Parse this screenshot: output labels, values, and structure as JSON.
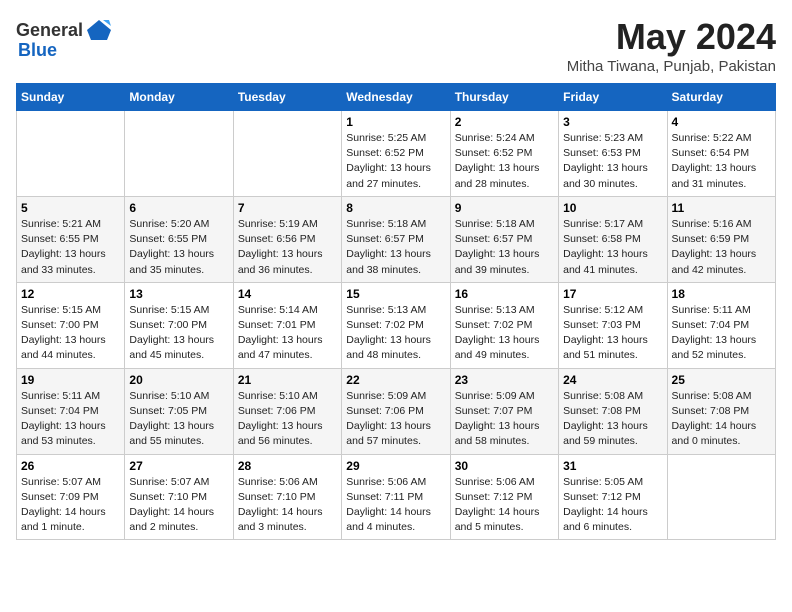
{
  "header": {
    "logo_general": "General",
    "logo_blue": "Blue",
    "month_title": "May 2024",
    "location": "Mitha Tiwana, Punjab, Pakistan"
  },
  "weekdays": [
    "Sunday",
    "Monday",
    "Tuesday",
    "Wednesday",
    "Thursday",
    "Friday",
    "Saturday"
  ],
  "weeks": [
    [
      {
        "day": "",
        "info": ""
      },
      {
        "day": "",
        "info": ""
      },
      {
        "day": "",
        "info": ""
      },
      {
        "day": "1",
        "info": "Sunrise: 5:25 AM\nSunset: 6:52 PM\nDaylight: 13 hours\nand 27 minutes."
      },
      {
        "day": "2",
        "info": "Sunrise: 5:24 AM\nSunset: 6:52 PM\nDaylight: 13 hours\nand 28 minutes."
      },
      {
        "day": "3",
        "info": "Sunrise: 5:23 AM\nSunset: 6:53 PM\nDaylight: 13 hours\nand 30 minutes."
      },
      {
        "day": "4",
        "info": "Sunrise: 5:22 AM\nSunset: 6:54 PM\nDaylight: 13 hours\nand 31 minutes."
      }
    ],
    [
      {
        "day": "5",
        "info": "Sunrise: 5:21 AM\nSunset: 6:55 PM\nDaylight: 13 hours\nand 33 minutes."
      },
      {
        "day": "6",
        "info": "Sunrise: 5:20 AM\nSunset: 6:55 PM\nDaylight: 13 hours\nand 35 minutes."
      },
      {
        "day": "7",
        "info": "Sunrise: 5:19 AM\nSunset: 6:56 PM\nDaylight: 13 hours\nand 36 minutes."
      },
      {
        "day": "8",
        "info": "Sunrise: 5:18 AM\nSunset: 6:57 PM\nDaylight: 13 hours\nand 38 minutes."
      },
      {
        "day": "9",
        "info": "Sunrise: 5:18 AM\nSunset: 6:57 PM\nDaylight: 13 hours\nand 39 minutes."
      },
      {
        "day": "10",
        "info": "Sunrise: 5:17 AM\nSunset: 6:58 PM\nDaylight: 13 hours\nand 41 minutes."
      },
      {
        "day": "11",
        "info": "Sunrise: 5:16 AM\nSunset: 6:59 PM\nDaylight: 13 hours\nand 42 minutes."
      }
    ],
    [
      {
        "day": "12",
        "info": "Sunrise: 5:15 AM\nSunset: 7:00 PM\nDaylight: 13 hours\nand 44 minutes."
      },
      {
        "day": "13",
        "info": "Sunrise: 5:15 AM\nSunset: 7:00 PM\nDaylight: 13 hours\nand 45 minutes."
      },
      {
        "day": "14",
        "info": "Sunrise: 5:14 AM\nSunset: 7:01 PM\nDaylight: 13 hours\nand 47 minutes."
      },
      {
        "day": "15",
        "info": "Sunrise: 5:13 AM\nSunset: 7:02 PM\nDaylight: 13 hours\nand 48 minutes."
      },
      {
        "day": "16",
        "info": "Sunrise: 5:13 AM\nSunset: 7:02 PM\nDaylight: 13 hours\nand 49 minutes."
      },
      {
        "day": "17",
        "info": "Sunrise: 5:12 AM\nSunset: 7:03 PM\nDaylight: 13 hours\nand 51 minutes."
      },
      {
        "day": "18",
        "info": "Sunrise: 5:11 AM\nSunset: 7:04 PM\nDaylight: 13 hours\nand 52 minutes."
      }
    ],
    [
      {
        "day": "19",
        "info": "Sunrise: 5:11 AM\nSunset: 7:04 PM\nDaylight: 13 hours\nand 53 minutes."
      },
      {
        "day": "20",
        "info": "Sunrise: 5:10 AM\nSunset: 7:05 PM\nDaylight: 13 hours\nand 55 minutes."
      },
      {
        "day": "21",
        "info": "Sunrise: 5:10 AM\nSunset: 7:06 PM\nDaylight: 13 hours\nand 56 minutes."
      },
      {
        "day": "22",
        "info": "Sunrise: 5:09 AM\nSunset: 7:06 PM\nDaylight: 13 hours\nand 57 minutes."
      },
      {
        "day": "23",
        "info": "Sunrise: 5:09 AM\nSunset: 7:07 PM\nDaylight: 13 hours\nand 58 minutes."
      },
      {
        "day": "24",
        "info": "Sunrise: 5:08 AM\nSunset: 7:08 PM\nDaylight: 13 hours\nand 59 minutes."
      },
      {
        "day": "25",
        "info": "Sunrise: 5:08 AM\nSunset: 7:08 PM\nDaylight: 14 hours\nand 0 minutes."
      }
    ],
    [
      {
        "day": "26",
        "info": "Sunrise: 5:07 AM\nSunset: 7:09 PM\nDaylight: 14 hours\nand 1 minute."
      },
      {
        "day": "27",
        "info": "Sunrise: 5:07 AM\nSunset: 7:10 PM\nDaylight: 14 hours\nand 2 minutes."
      },
      {
        "day": "28",
        "info": "Sunrise: 5:06 AM\nSunset: 7:10 PM\nDaylight: 14 hours\nand 3 minutes."
      },
      {
        "day": "29",
        "info": "Sunrise: 5:06 AM\nSunset: 7:11 PM\nDaylight: 14 hours\nand 4 minutes."
      },
      {
        "day": "30",
        "info": "Sunrise: 5:06 AM\nSunset: 7:12 PM\nDaylight: 14 hours\nand 5 minutes."
      },
      {
        "day": "31",
        "info": "Sunrise: 5:05 AM\nSunset: 7:12 PM\nDaylight: 14 hours\nand 6 minutes."
      },
      {
        "day": "",
        "info": ""
      }
    ]
  ]
}
